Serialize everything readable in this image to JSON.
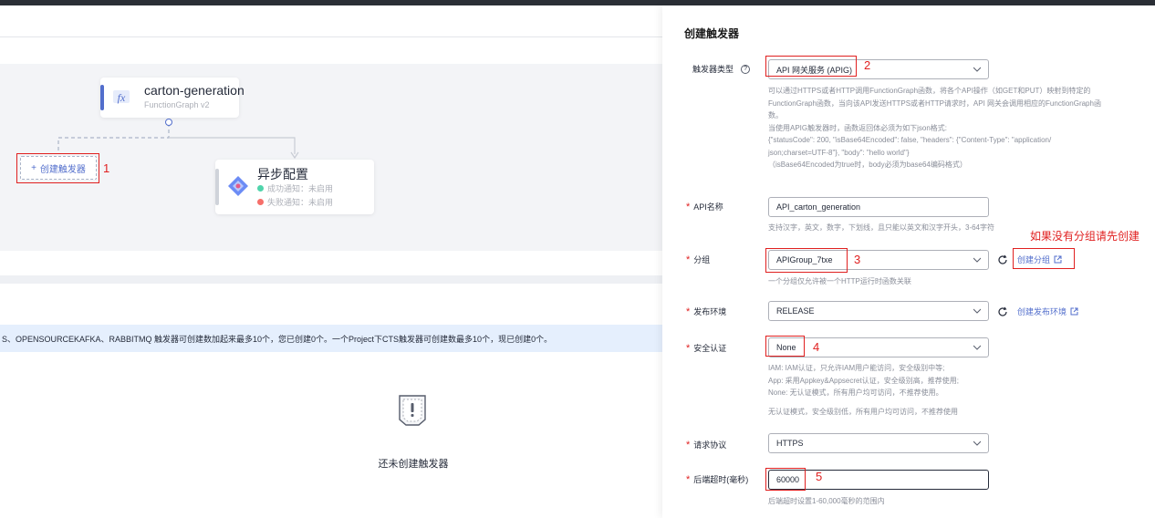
{
  "workflow": {
    "function_node": {
      "name": "carton-generation",
      "subtitle": "FunctionGraph v2"
    },
    "add_trigger_label": "创建触发器",
    "async_node": {
      "title": "异步配置",
      "success_text": "成功通知：未启用",
      "failure_text": "失败通知：未启用"
    }
  },
  "notice_text": "S、OPENSOURCEKAFKA、RABBITMQ 触发器可创建数加起来最多10个，您已创建0个。一个Project下CTS触发器可创建数最多10个，现已创建0个。",
  "empty_state": {
    "text": "还未创建触发器"
  },
  "annotations": [
    "1",
    "2",
    "3",
    "4",
    "5"
  ],
  "annotation_note": "如果没有分组请先创建",
  "drawer": {
    "title": "创建触发器",
    "trigger_type": {
      "label": "触发器类型",
      "value": "API 网关服务 (APIG)",
      "description": [
        "可以通过HTTPS或者HTTP调用FunctionGraph函数，将各个API操作（如GET和PUT）映射到特定的",
        "FunctionGraph函数，当向该API发送HTTPS或者HTTP请求时，API 网关会调用相应的FunctionGraph函",
        "数。",
        "当使用APIG触发器时，函数返回体必须为如下json格式:",
        "{\"statusCode\": 200, \"isBase64Encoded\": false, \"headers\": {\"Content-Type\": \"application/",
        "json;charset=UTF-8\"}, \"body\": \"hello world\"}",
        "（isBase64Encoded为true时，body必须为base64编码格式）"
      ]
    },
    "api_name": {
      "label": "API名称",
      "value": "API_carton_generation",
      "hint": "支持汉字，英文，数字，下划线，且只能以英文和汉字开头，3-64字符"
    },
    "group": {
      "label": "分组",
      "value": "APIGroup_7txe",
      "hint": "一个分组仅允许被一个HTTP运行时函数关联",
      "create_link": "创建分组"
    },
    "environment": {
      "label": "发布环境",
      "value": "RELEASE",
      "create_link": "创建发布环境"
    },
    "auth": {
      "label": "安全认证",
      "value": "None",
      "description": [
        "IAM:  IAM认证，只允许IAM用户能访问，安全级别中等;",
        "App:  采用Appkey&Appsecret认证，安全级别高，推荐使用;",
        "None:  无认证模式，所有用户均可访问，不推荐使用。"
      ],
      "warning": "无认证模式，安全级别低，所有用户均可访问，不推荐使用"
    },
    "protocol": {
      "label": "请求协议",
      "value": "HTTPS"
    },
    "timeout": {
      "label": "后端超时(毫秒)",
      "value": "60000",
      "hint": "后端超时设置1-60,000毫秒的范围内"
    }
  },
  "colors": {
    "accent": "#526ecc",
    "annotation_red": "#e02020",
    "success": "#50d4ab",
    "failure": "#f66f6a"
  }
}
